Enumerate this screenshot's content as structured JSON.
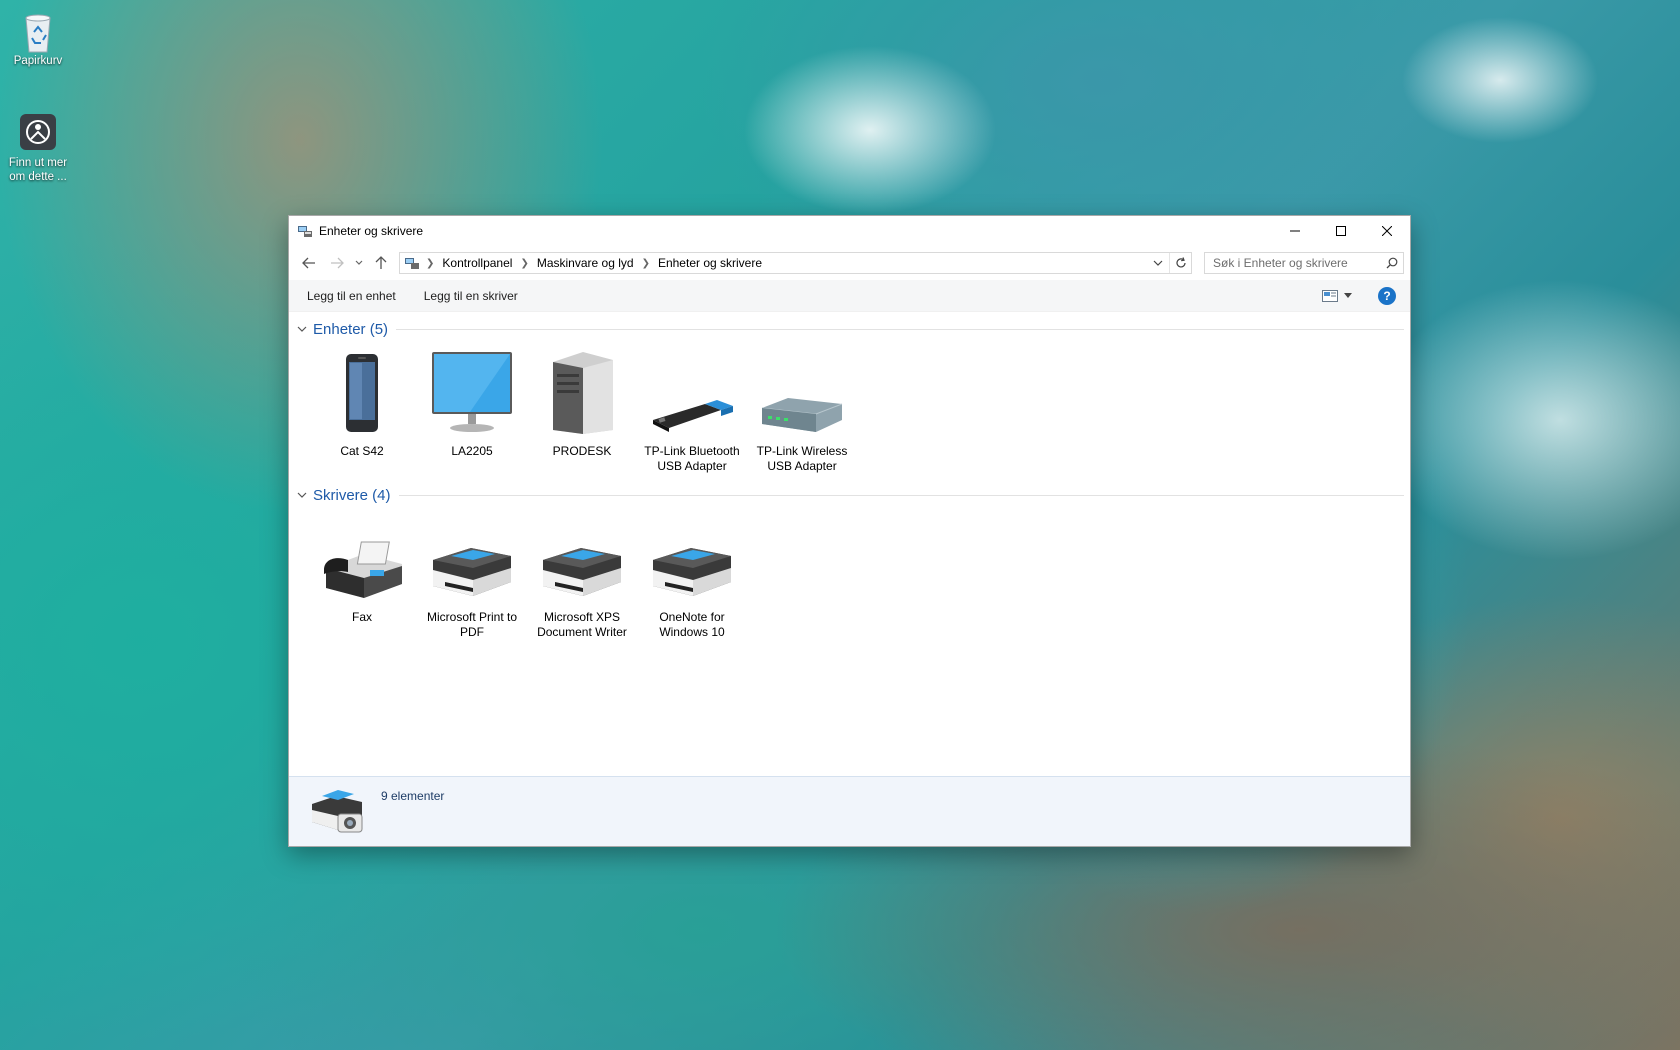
{
  "desktop": {
    "icons": [
      {
        "label": "Papirkurv",
        "icon": "recycle-bin-icon"
      },
      {
        "label": "Finn ut mer om dette ...",
        "icon": "spotlight-icon"
      }
    ]
  },
  "window": {
    "title": "Enheter og skrivere",
    "controls": {
      "minimize": "minimize-icon",
      "maximize": "maximize-icon",
      "close": "close-icon"
    }
  },
  "address": {
    "breadcrumbs": [
      "Kontrollpanel",
      "Maskinvare og lyd",
      "Enheter og skrivere"
    ]
  },
  "search": {
    "placeholder": "Søk i Enheter og skrivere"
  },
  "commands": {
    "add_device": "Legg til en enhet",
    "add_printer": "Legg til en skriver"
  },
  "groups": {
    "devices": {
      "title": "Enheter (5)",
      "items": [
        {
          "label": "Cat S42",
          "icon": "phone-icon"
        },
        {
          "label": "LA2205",
          "icon": "monitor-icon"
        },
        {
          "label": "PRODESK",
          "icon": "desktop-tower-icon"
        },
        {
          "label": "TP-Link Bluetooth USB Adapter",
          "icon": "usb-dongle-icon"
        },
        {
          "label": "TP-Link Wireless USB Adapter",
          "icon": "network-adapter-icon"
        }
      ]
    },
    "printers": {
      "title": "Skrivere (4)",
      "items": [
        {
          "label": "Fax",
          "icon": "fax-icon"
        },
        {
          "label": "Microsoft Print to PDF",
          "icon": "printer-icon"
        },
        {
          "label": "Microsoft XPS Document Writer",
          "icon": "printer-icon"
        },
        {
          "label": "OneNote for Windows 10",
          "icon": "printer-icon"
        }
      ]
    }
  },
  "status": {
    "count_text": "9 elementer"
  },
  "colors": {
    "group_header": "#1e5aa8",
    "help": "#1a73c8",
    "statusbar_bg": "#f1f5fb"
  }
}
